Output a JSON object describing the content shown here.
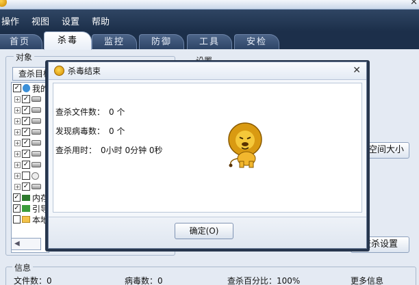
{
  "menu": [
    "操作",
    "视图",
    "设置",
    "帮助"
  ],
  "tabs": [
    "首页",
    "杀毒",
    "监控",
    "防御",
    "工具",
    "安检"
  ],
  "active_tab": 1,
  "left_panel": {
    "group_title": "对象",
    "select_button": "查杀目标",
    "tree_first_label": "我的",
    "mem_label": "内存",
    "boot_label": "引导",
    "mail_label": "本地"
  },
  "settings_group_title": "设置",
  "right_buttons": {
    "space_size": "空间大小",
    "scan_settings": "查杀设置"
  },
  "info": {
    "group_title": "信息",
    "files": "文件数：0",
    "viruses": "病毒数：0",
    "percent": "查杀百分比：100%",
    "more": "更多信息"
  },
  "dialog": {
    "title": "杀毒结束",
    "files_label": "查杀文件数：",
    "files_value": "0 个",
    "viruses_label": "发现病毒数：",
    "viruses_value": "0 个",
    "time_label": "查杀用时：",
    "time_value": "0小时 0分钟 0秒",
    "ok_label": "确定(O)"
  },
  "colors": {
    "menubar": "#1c2f4a",
    "dialog_frame": "#27364d",
    "panel": "#e4eaf3"
  }
}
